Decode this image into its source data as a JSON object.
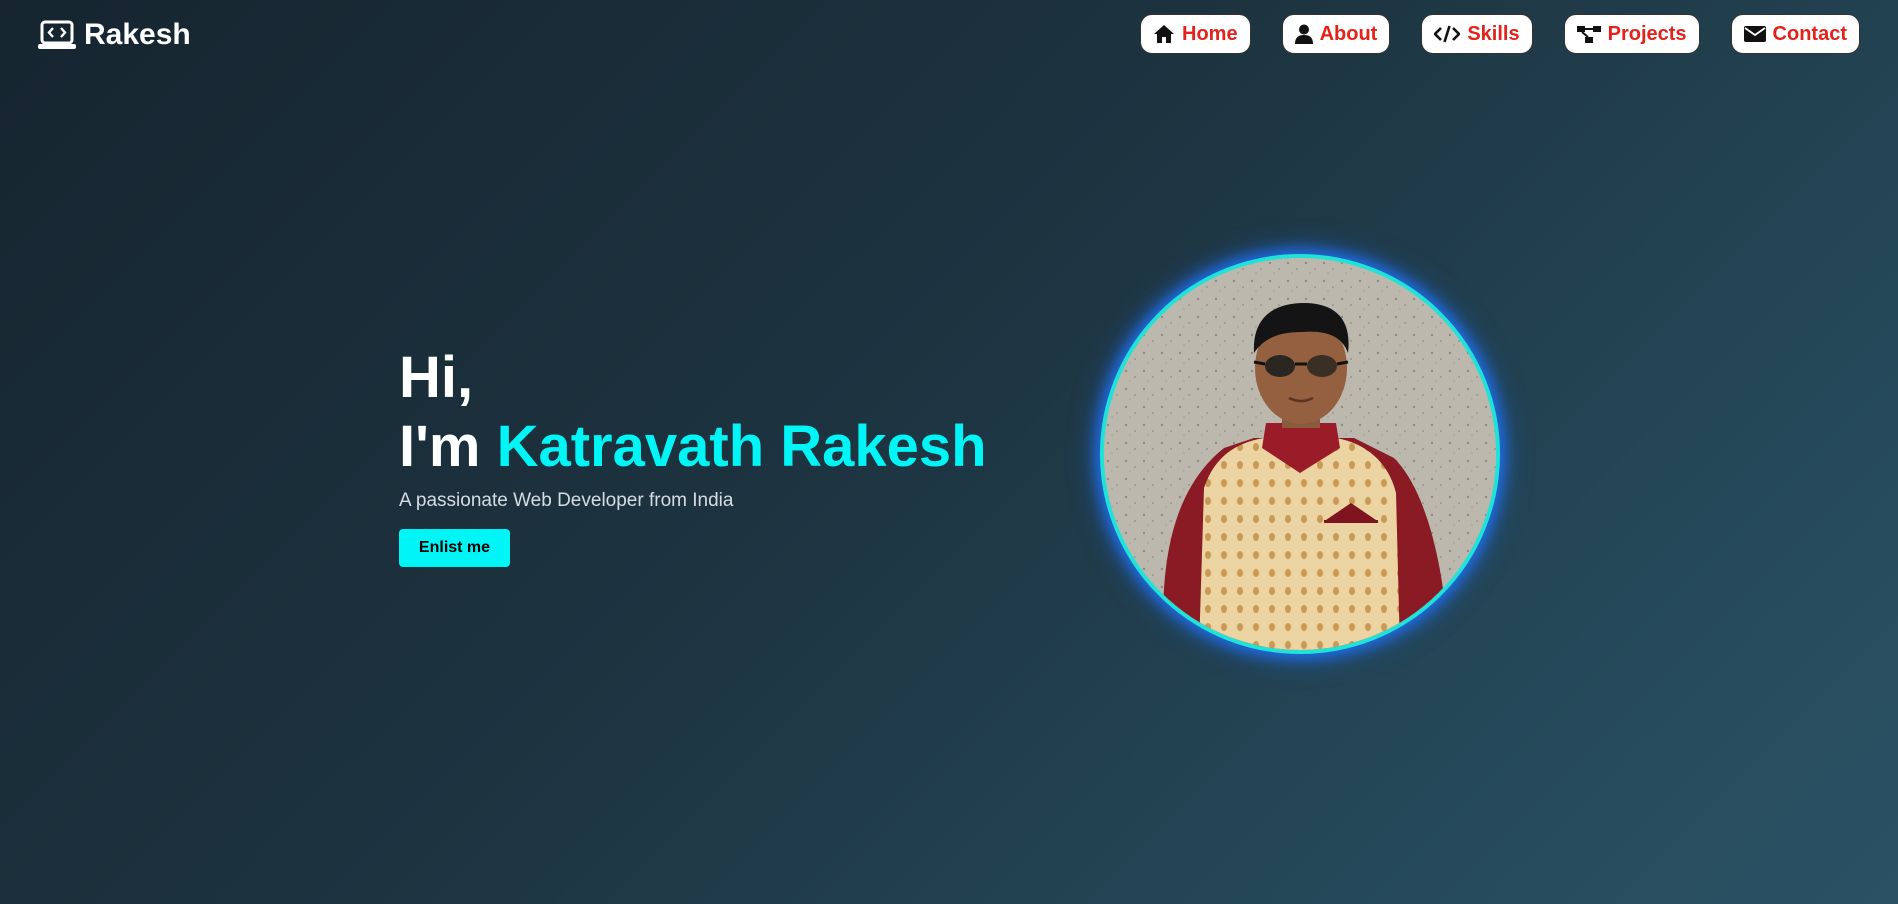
{
  "brand": {
    "name": "Rakesh",
    "icon": "laptop-code-icon"
  },
  "nav": [
    {
      "label": "Home",
      "icon": "home-icon"
    },
    {
      "label": "About",
      "icon": "user-icon"
    },
    {
      "label": "Skills",
      "icon": "code-icon"
    },
    {
      "label": "Projects",
      "icon": "project-diagram-icon"
    },
    {
      "label": "Contact",
      "icon": "envelope-icon"
    }
  ],
  "hero": {
    "greeting": "Hi,",
    "intro": "I'm ",
    "name": "Katravath Rakesh",
    "subtitle": "A passionate Web Developer from India",
    "cta_label": "Enlist me"
  },
  "photo": {
    "description": "profile-photo"
  },
  "colors": {
    "accent": "#00f6f6",
    "nav_text": "#e3221b",
    "photo_border": "#1fe3d7",
    "photo_glow": "#1f6ff0"
  }
}
